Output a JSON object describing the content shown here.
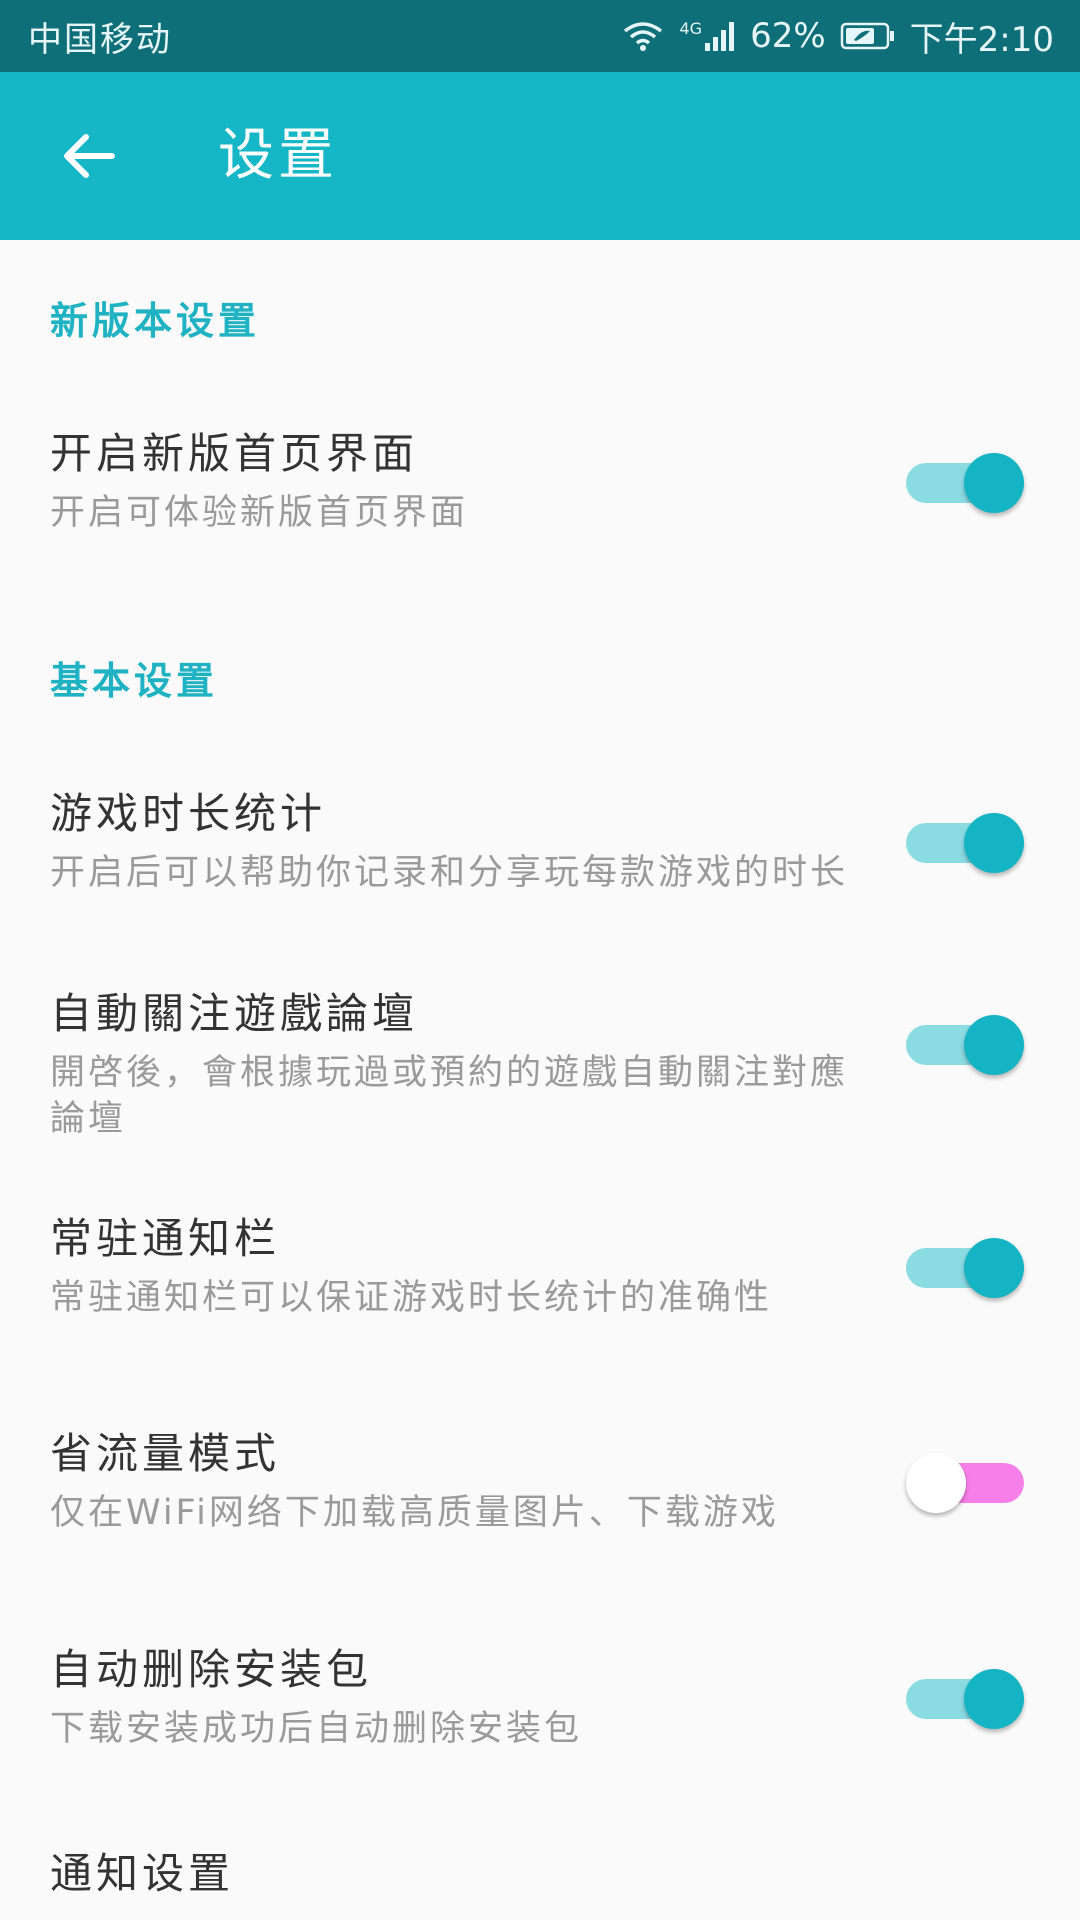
{
  "status_bar": {
    "carrier": "中国移动",
    "network": "4G",
    "battery_percent": "62%",
    "time": "下午2:10",
    "icons": [
      "wifi-icon",
      "signal-icon",
      "battery-icon"
    ]
  },
  "app_bar": {
    "title": "设置",
    "back_icon": "arrow-left-icon",
    "background": "#15b6c6"
  },
  "colors": {
    "accent": "#1fb2c2",
    "switch_on_track": "#8bdbe3",
    "switch_on_thumb": "#14b4c5",
    "switch_off_track": "#f77fe9",
    "status_bar": "#0f6f79"
  },
  "sections": {
    "new_version": {
      "header": "新版本设置",
      "items": [
        {
          "title": "开启新版首页界面",
          "desc": "开启可体验新版首页界面",
          "enabled": true
        }
      ]
    },
    "basic": {
      "header": "基本设置",
      "items": [
        {
          "title": "游戏时长统计",
          "desc": "开启后可以帮助你记录和分享玩每款游戏的时长",
          "enabled": true
        },
        {
          "title": "自動關注遊戲論壇",
          "desc": "開啓後，會根據玩過或預約的遊戲自動關注對應論壇",
          "enabled": true
        },
        {
          "title": "常驻通知栏",
          "desc": "常驻通知栏可以保证游戏时长统计的准确性",
          "enabled": true
        },
        {
          "title": "省流量模式",
          "desc": "仅在WiFi网络下加载高质量图片、下载游戏",
          "enabled": false
        },
        {
          "title": "自动删除安装包",
          "desc": "下载安装成功后自动删除安装包",
          "enabled": true
        }
      ]
    },
    "notification": {
      "header": "通知设置"
    }
  }
}
